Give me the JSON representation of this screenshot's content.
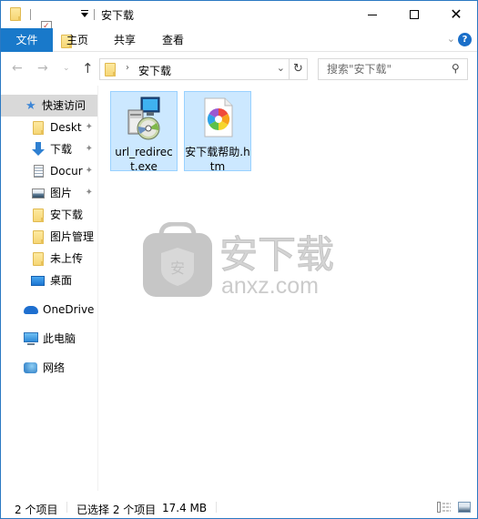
{
  "window": {
    "title": "安下载",
    "controls": {
      "minimize": "minimize",
      "maximize": "maximize",
      "close": "close"
    }
  },
  "quick_access_toolbar": [
    {
      "icon": "folder-icon"
    },
    {
      "icon": "properties-icon"
    },
    {
      "icon": "new-folder-icon"
    },
    {
      "icon": "customize-dropdown-icon"
    }
  ],
  "ribbon": {
    "tabs": [
      {
        "label": "文件",
        "active": true
      },
      {
        "label": "主页"
      },
      {
        "label": "共享"
      },
      {
        "label": "查看"
      }
    ],
    "expand_icon": "chevron-down-icon",
    "help_label": "?"
  },
  "navigation": {
    "back_icon": "←",
    "forward_icon": "→",
    "recent_icon": "⌄",
    "up_icon": "↑",
    "address": {
      "separator": "›",
      "breadcrumb": [
        "安下载"
      ],
      "dropdown_icon": "⌄",
      "refresh_icon": "↻"
    },
    "search": {
      "placeholder": "搜索\"安下载\"",
      "value": "",
      "icon": "⚲"
    }
  },
  "sidebar": {
    "items": [
      {
        "label": "快速访问",
        "icon": "star-icon",
        "selected": true
      },
      {
        "label": "Deskt",
        "icon": "folder-icon",
        "pinned": true
      },
      {
        "label": "下载",
        "icon": "download-icon",
        "pinned": true
      },
      {
        "label": "Docur",
        "icon": "document-icon",
        "pinned": true
      },
      {
        "label": "图片",
        "icon": "pictures-icon",
        "pinned": true
      },
      {
        "label": "安下载",
        "icon": "folder-icon"
      },
      {
        "label": "图片管理",
        "icon": "folder-icon"
      },
      {
        "label": "未上传",
        "icon": "folder-icon"
      },
      {
        "label": "桌面",
        "icon": "desktop-icon"
      },
      {
        "label": "OneDrive",
        "icon": "onedrive-icon"
      },
      {
        "label": "此电脑",
        "icon": "this-pc-icon"
      },
      {
        "label": "网络",
        "icon": "network-icon"
      }
    ],
    "pin_glyph": "📌"
  },
  "files": [
    {
      "name": "url_redirect.exe",
      "display": "url_redirect.exe",
      "type": "installer",
      "selected": true
    },
    {
      "name": "安下载帮助.htm",
      "display": "安下载帮助.htm",
      "type": "htm",
      "selected": true
    }
  ],
  "watermark": {
    "brand_cn": "安下载",
    "brand_url": "anxz.com",
    "badge_char": "安"
  },
  "status_bar": {
    "item_count": "2 个项目",
    "selection": "已选择 2 个项目",
    "size": "17.4 MB"
  },
  "colors": {
    "accent": "#1979ca",
    "selection_bg": "#cce8ff",
    "selection_border": "#99d1ff",
    "sidebar_selected": "#d9d9d9"
  }
}
